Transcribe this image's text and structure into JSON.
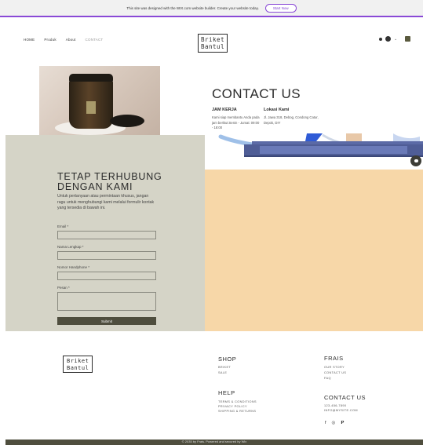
{
  "banner": {
    "text": "This site was designed with the WIX.com website builder. Create your website today.",
    "button": "Start Now"
  },
  "nav": {
    "items": [
      "HOME",
      "Produk",
      "About",
      "CONTACT"
    ]
  },
  "logo": {
    "line1": "Briket",
    "line2": "Bantul"
  },
  "header_icons": [
    "bell-icon",
    "avatar-icon",
    "chevron-down-icon",
    "cart-icon"
  ],
  "contact": {
    "title": "CONTACT US",
    "hours_title": "JAM KERJA",
    "hours_text": "Kami siap membantu Anda pada jam berikut:Senin - Jumat: 09:00 - 18:00",
    "location_title": "Lokasi Kami",
    "location_text": "Jl. Jawa 318, Debog, Condong Catur, Depok, DIY"
  },
  "form": {
    "title_line1": "TETAP TERHUBUNG",
    "title_line2": "DENGAN KAMI",
    "description": "Untuk pertanyaan atau permintaan khusus, jangan ragu untuk menghubungi kami melalui formulir kontak yang tersedia di bawah ini.",
    "email_label": "Email *",
    "name_label": "Nama Lengkap *",
    "phone_label": "Nomor Handphone *",
    "message_label": "Pesan *",
    "submit": "Submit"
  },
  "footer": {
    "logo_line1": "Briket",
    "logo_line2": "Bantul",
    "shop_title": "SHOP",
    "shop_links": [
      "BRIKET",
      "SALE"
    ],
    "frais_title": "FRAIS",
    "frais_links": [
      "OUR STORY",
      "CONTACT US",
      "FAQ"
    ],
    "help_title": "HELP",
    "help_links": [
      "TERMS & CONDITIONS",
      "PRIVACY POLICY",
      "SHIPPING & RETURNS"
    ],
    "contact_title": "CONTACT US",
    "contact_lines": [
      "123-456-7890",
      "INFO@MYSITE.COM"
    ],
    "social_icons": [
      "facebook-icon",
      "instagram-icon",
      "pinterest-icon"
    ],
    "copyright": "© 2035 by Frais. Powered and secured by Wix"
  },
  "colors": {
    "panel": "#d5d4c7",
    "peach": "#f7d7a8",
    "dark_olive": "#4f4e3e",
    "wix_purple": "#8a49d6"
  }
}
